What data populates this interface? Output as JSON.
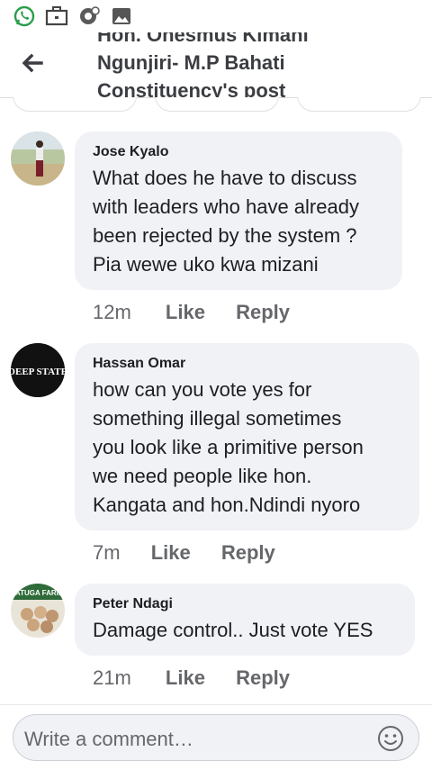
{
  "status_bar": {
    "icons": [
      "whatsapp-icon",
      "briefcase-icon",
      "sync-icon",
      "image-icon"
    ]
  },
  "header": {
    "title": "Hon. Onesmus Kimani\nNgunjiri- M.P Bahati\nConstituency's post"
  },
  "comments": [
    {
      "author": "Jose Kyalo",
      "text": "What does he have to discuss\nwith leaders who have already\nbeen rejected by the system ?\nPia wewe uko kwa mizani",
      "time": "12m",
      "like_label": "Like",
      "reply_label": "Reply",
      "avatar": "person-photo"
    },
    {
      "author": "Hassan Omar",
      "text": " how can you vote yes for\nsomething illegal sometimes\nyou  look like a primitive  person\n we need people like hon.\nKangata and hon.Ndindi nyoro",
      "time": "7m",
      "like_label": "Like",
      "reply_label": "Reply",
      "avatar_text": "DEEP STATE"
    },
    {
      "author": "Peter Ndagi",
      "text": "Damage control.. Just vote YES",
      "time": "21m",
      "like_label": "Like",
      "reply_label": "Reply",
      "avatar_text": "IATUGA FARM"
    }
  ],
  "composer": {
    "placeholder": "Write a comment…"
  },
  "colors": {
    "bubble": "#f0f2f5",
    "meta_text": "#65676b",
    "primary_text": "#1c1e21",
    "whatsapp": "#25d366"
  }
}
